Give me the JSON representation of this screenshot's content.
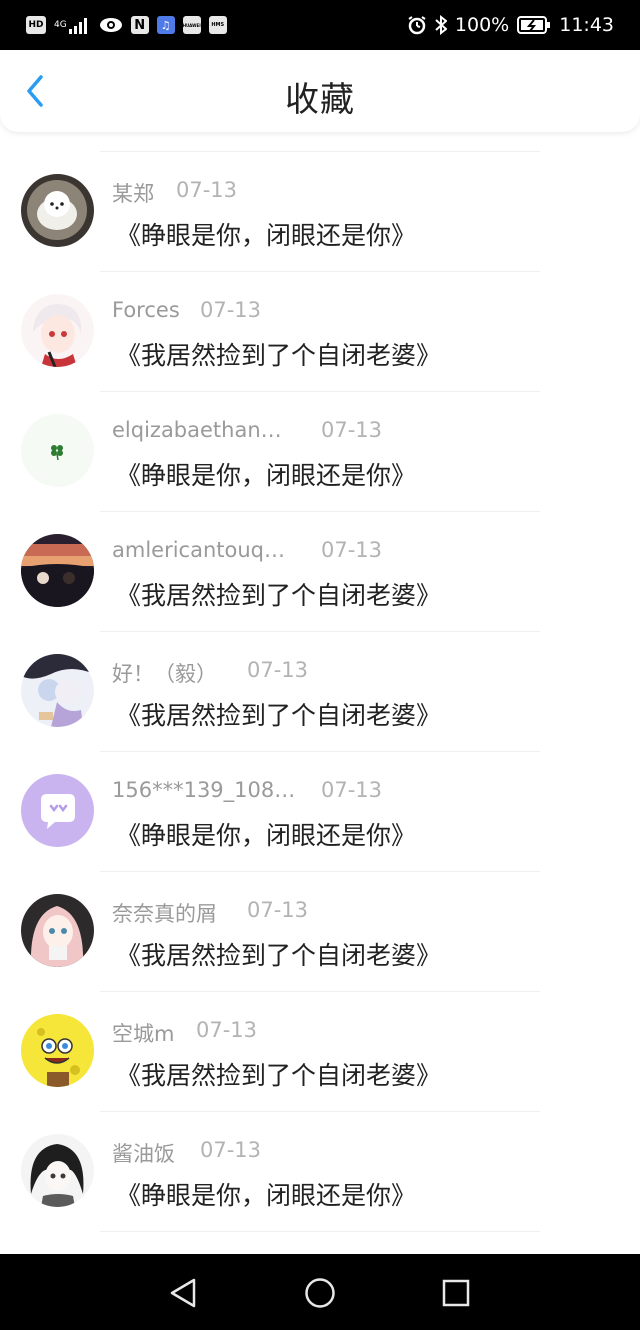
{
  "status_bar": {
    "left_badges": [
      "HD",
      "4G"
    ],
    "app_icons": [
      "N",
      "♫",
      "HUAWEI",
      "HMS"
    ],
    "battery": "100%",
    "time": "11:43"
  },
  "header": {
    "title": "收藏"
  },
  "colors": {
    "accent": "#2a9cf2",
    "status_bar_bg": "#000000",
    "nav_bar_bg": "#000000",
    "title_text": "#222222",
    "meta_text": "#9a9a9a"
  },
  "items": [
    {
      "username": "某郑",
      "date": "07-13",
      "title": "《睁眼是你，闭眼还是你》",
      "avatar": "white-dog-avatar"
    },
    {
      "username": "Forces",
      "date": "07-13",
      "title": "《我居然捡到了个自闭老婆》",
      "avatar": "anime-girl-avatar"
    },
    {
      "username": "elqizabaethan…",
      "date": "07-13",
      "title": "《睁眼是你，闭眼还是你》",
      "avatar": "clover-avatar"
    },
    {
      "username": "amlericantouq…",
      "date": "07-13",
      "title": "《我居然捡到了个自闭老婆》",
      "avatar": "car-sunset-avatar"
    },
    {
      "username": "好！（毅）",
      "date": "07-13",
      "title": "《我居然捡到了个自闭老婆》",
      "avatar": "anime-couple-avatar"
    },
    {
      "username": "156***139_108…",
      "date": "07-13",
      "title": "《睁眼是你，闭眼还是你》",
      "avatar": "chat-bubble-avatar"
    },
    {
      "username": "奈奈真的屑",
      "date": "07-13",
      "title": "《我居然捡到了个自闭老婆》",
      "avatar": "pink-hair-avatar"
    },
    {
      "username": "空城m",
      "date": "07-13",
      "title": "《我居然捡到了个自闭老婆》",
      "avatar": "spongebob-avatar"
    },
    {
      "username": "酱油饭",
      "date": "07-13",
      "title": "《睁眼是你，闭眼还是你》",
      "avatar": "dark-hair-avatar"
    }
  ],
  "nav_bar": {
    "icons": [
      "back-triangle-icon",
      "home-circle-icon",
      "recents-square-icon"
    ]
  }
}
